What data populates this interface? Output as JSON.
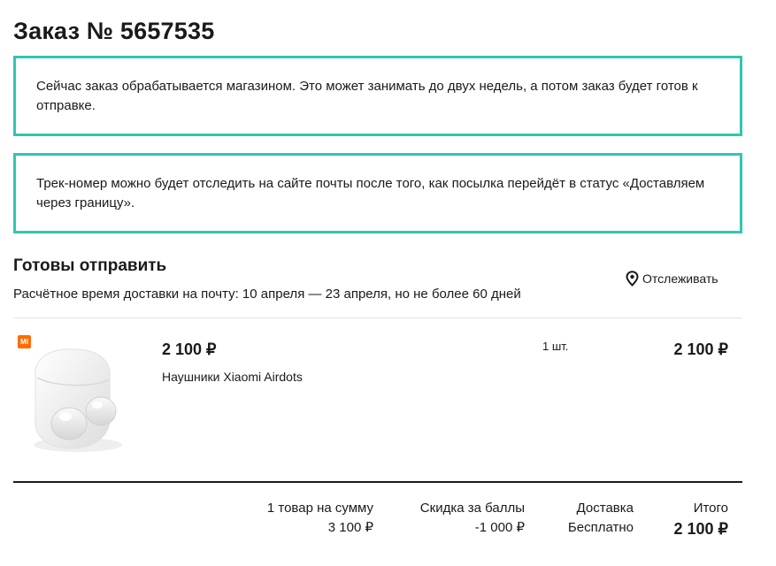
{
  "order": {
    "title": "Заказ № 5657535"
  },
  "notices": [
    "Сейчас заказ обрабатывается магазином. Это может занимать до двух недель, а потом заказ будет готов к отправке.",
    "Трек-номер можно будет отследить на сайте почты после того, как посылка перейдёт в статус «Доставляем через границу»."
  ],
  "shipment": {
    "title": "Готовы отправить",
    "delivery_time": "Расчётное время доставки на почту: 10 апреля — 23 апреля, но не более 60 дней",
    "track_label": "Отслеживать",
    "track_icon": "location-pin-icon"
  },
  "item": {
    "shop_badge": "MI",
    "price": "2 100 ₽",
    "name": "Наушники Xiaomi Airdots",
    "quantity": "1 шт.",
    "total": "2 100 ₽"
  },
  "summary": {
    "items_label": "1 товар на сумму",
    "items_value": "3 100 ₽",
    "discount_label": "Скидка за баллы",
    "discount_value": "-1 000 ₽",
    "delivery_label": "Доставка",
    "delivery_value": "Бесплатно",
    "total_label": "Итого",
    "total_value": "2 100 ₽"
  },
  "colors": {
    "accent_border": "#2ec7b1",
    "shop_badge": "#ff6b00",
    "text": "#1a1a1a"
  }
}
